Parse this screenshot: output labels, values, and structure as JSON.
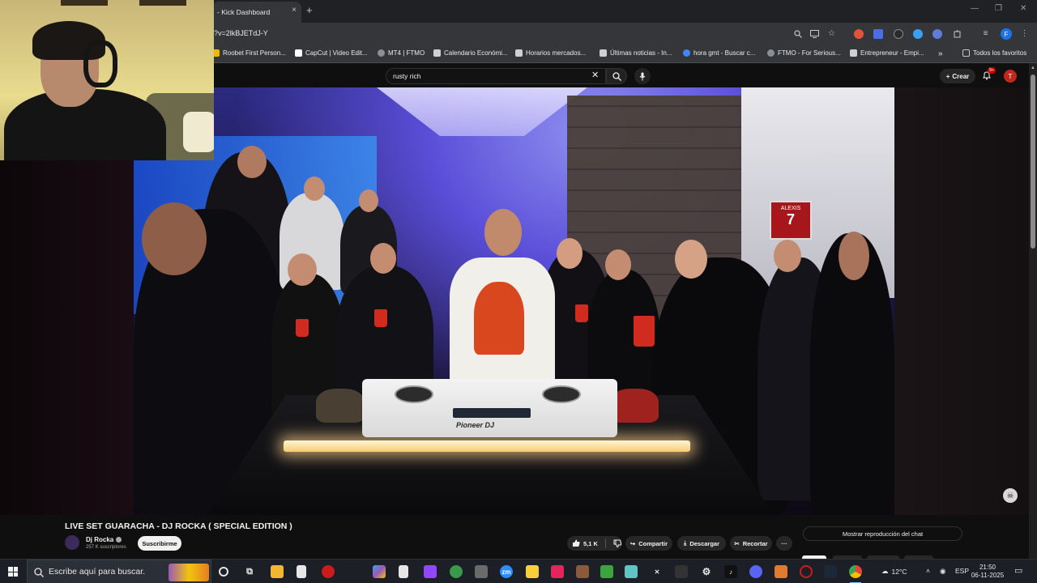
{
  "browser": {
    "tab_title": "- Kick Dashboard",
    "tab_close_icon": "×",
    "new_tab_icon": "+",
    "url": "?v=2lkBJETdJ-Y",
    "window_controls": {
      "minimize": "—",
      "restore": "❐",
      "close": "✕"
    }
  },
  "bookmarks": [
    {
      "label": "Roobet First Person...",
      "icon": "roobet-icon",
      "color": "#f5b400"
    },
    {
      "label": "CapCut | Video Edit...",
      "icon": "capcut-icon",
      "color": "#ffffff"
    },
    {
      "label": "MT4 | FTMO",
      "icon": "globe-icon",
      "color": "#9aa0a6"
    },
    {
      "label": "Calendario Económi...",
      "icon": "investing-icon",
      "color": "#cfcfcf"
    },
    {
      "label": "Horarios mercados...",
      "icon": "investing-icon",
      "color": "#cfcfcf"
    },
    {
      "label": "Últimas noticias - In...",
      "icon": "investing-icon",
      "color": "#cfcfcf"
    },
    {
      "label": "hora gmt - Buscar c...",
      "icon": "google-icon",
      "color": "#4285f4"
    },
    {
      "label": "FTMO - For Serious...",
      "icon": "globe-icon",
      "color": "#9aa0a6"
    },
    {
      "label": "Entrepreneur - Empi...",
      "icon": "entrepreneur-icon",
      "color": "#d0d0d0"
    }
  ],
  "bookmarks_more": "»",
  "all_bookmarks": "Todos los favoritos",
  "youtube": {
    "search_value": "rusty rich",
    "create_label": "Crear",
    "notif_count": "9+",
    "avatar_letter": "T",
    "video_title": "LIVE SET GUARACHA - DJ ROCKA ( SPECIAL EDITION )",
    "channel_name": "Dj Rocka",
    "subscribers": "257 K suscriptores",
    "subscribe_label": "Suscribirme",
    "likes": "5,1 K",
    "share_label": "Compartir",
    "download_label": "Descargar",
    "clip_label": "Recortar",
    "more_label": "···",
    "chat_replay_label": "Mostrar reproducción del chat",
    "controller_brand": "Pioneer DJ",
    "jersey_name": "ALEXIS",
    "jersey_number": "7"
  },
  "taskbar": {
    "search_placeholder": "Escribe aquí para buscar.",
    "weather": "12°C",
    "language": "ESP",
    "time": "21:50",
    "date": "06-11-2025"
  },
  "colors": {
    "accent_red": "#cc0000",
    "youtube_bg": "#0f0f0f",
    "chrome_bg": "#35363a"
  }
}
